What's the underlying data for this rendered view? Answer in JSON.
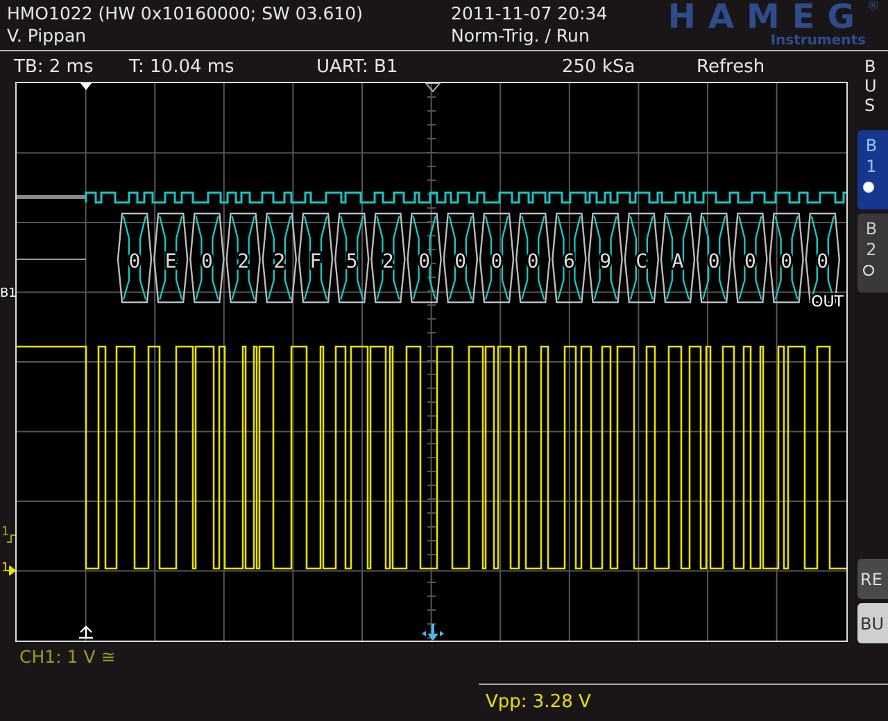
{
  "header": {
    "title": "HMO1022 (HW 0x10160000; SW 03.610)",
    "user": "V. Pippan",
    "datetime": "2011-11-07 20:34",
    "status": "Norm-Trig. / Run"
  },
  "logo": {
    "brand": "HAMEG",
    "mark": "®",
    "subtitle": "Instruments"
  },
  "info_bar": [
    "TB: 2 ms",
    "T: 10.04 ms",
    "UART: B1",
    "250 kSa",
    "Refresh"
  ],
  "decode": {
    "label": "B1",
    "symbols": [
      "0",
      "E",
      "0",
      "2",
      "2",
      "F",
      "5",
      "2",
      "0",
      "0",
      "0",
      "0",
      "6",
      "9",
      "C",
      "A",
      "0",
      "0",
      "0",
      "0"
    ],
    "end_label": "OUT"
  },
  "level_markers": [
    {
      "label": "1",
      "kind": "trigger"
    },
    {
      "label": "1",
      "kind": "ground"
    }
  ],
  "sidebar": {
    "title": "BUS",
    "buses": [
      {
        "label": "B1",
        "selected": true
      },
      {
        "label": "B2",
        "selected": false
      }
    ],
    "softkeys": [
      {
        "label": "RE",
        "selected": false
      },
      {
        "label": "BU",
        "selected": true
      }
    ]
  },
  "channel_label": "CH1: 1 V ≅",
  "measurement": "Vpp: 3.28 V"
}
